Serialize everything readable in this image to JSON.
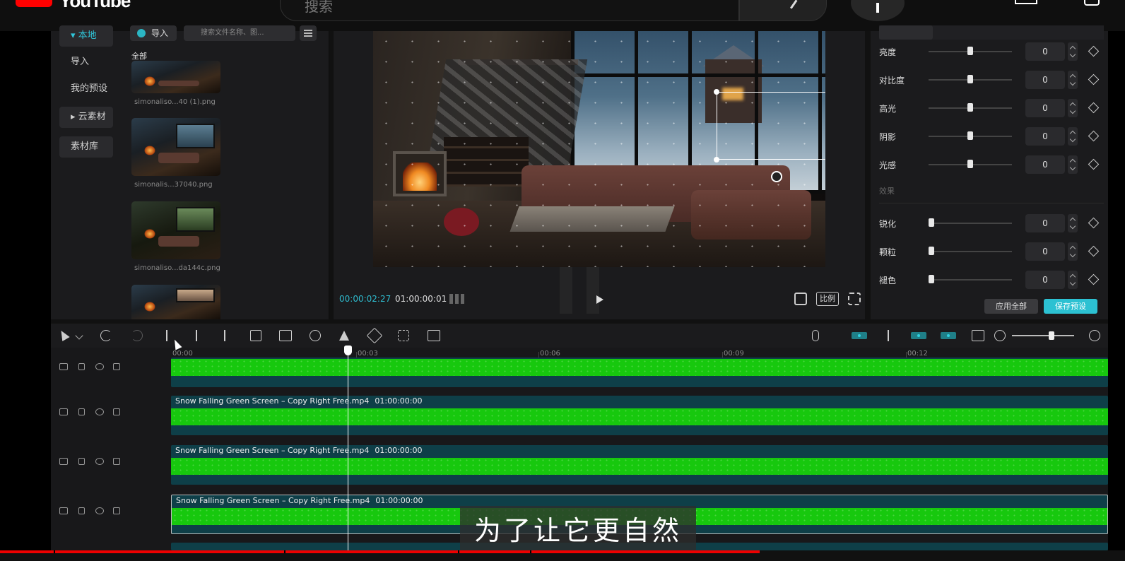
{
  "youtube": {
    "logo_text": "YouTube",
    "search_placeholder": "搜索"
  },
  "sidebar": {
    "items": [
      {
        "label": "▾ 本地",
        "active": true
      },
      {
        "label": "导入"
      },
      {
        "label": "我的预设"
      },
      {
        "label": "▸ 云素材"
      },
      {
        "label": "素材库"
      }
    ]
  },
  "media": {
    "import_label": "导入",
    "search_placeholder": "搜索文件名称、图...",
    "section_label": "全部",
    "items": [
      {
        "name": "simonaliso...40 (1).png"
      },
      {
        "name": "simonalis...37040.png"
      },
      {
        "name": "simonaliso...da144c.png"
      },
      {
        "name": ""
      }
    ]
  },
  "preview": {
    "current_time": "00:00:02:27",
    "duration": "01:00:00:01",
    "ratio_label": "比例"
  },
  "properties": {
    "adjustments": [
      {
        "label": "亮度",
        "value": "0",
        "level": 0.5
      },
      {
        "label": "对比度",
        "value": "0",
        "level": 0.5
      },
      {
        "label": "高光",
        "value": "0",
        "level": 0.5
      },
      {
        "label": "阴影",
        "value": "0",
        "level": 0.5
      },
      {
        "label": "光感",
        "value": "0",
        "level": 0.5
      }
    ],
    "effects_label": "效果",
    "effects": [
      {
        "label": "锐化",
        "value": "0",
        "level": 0
      },
      {
        "label": "颗粒",
        "value": "0",
        "level": 0
      },
      {
        "label": "褪色",
        "value": "0",
        "level": 0
      }
    ],
    "apply_all_label": "应用全部",
    "save_preset_label": "保存预设"
  },
  "timeline": {
    "ruler": [
      "00:00",
      "00:03",
      "00:06",
      "00:09",
      "00:12"
    ],
    "clips": [
      {
        "name": "",
        "duration": ""
      },
      {
        "name": "Snow Falling Green Screen – Copy Right Free.mp4",
        "duration": "01:00:00:00"
      },
      {
        "name": "Snow Falling Green Screen – Copy Right Free.mp4",
        "duration": "01:00:00:00"
      },
      {
        "name": "Snow Falling Green Screen – Copy Right Free.mp4",
        "duration": "01:00:00:00"
      }
    ]
  },
  "subtitle": "为了让它更自然",
  "colors": {
    "accent": "#2cc1d2",
    "green_screen": "#17c80e",
    "youtube_red": "#ff0000"
  }
}
